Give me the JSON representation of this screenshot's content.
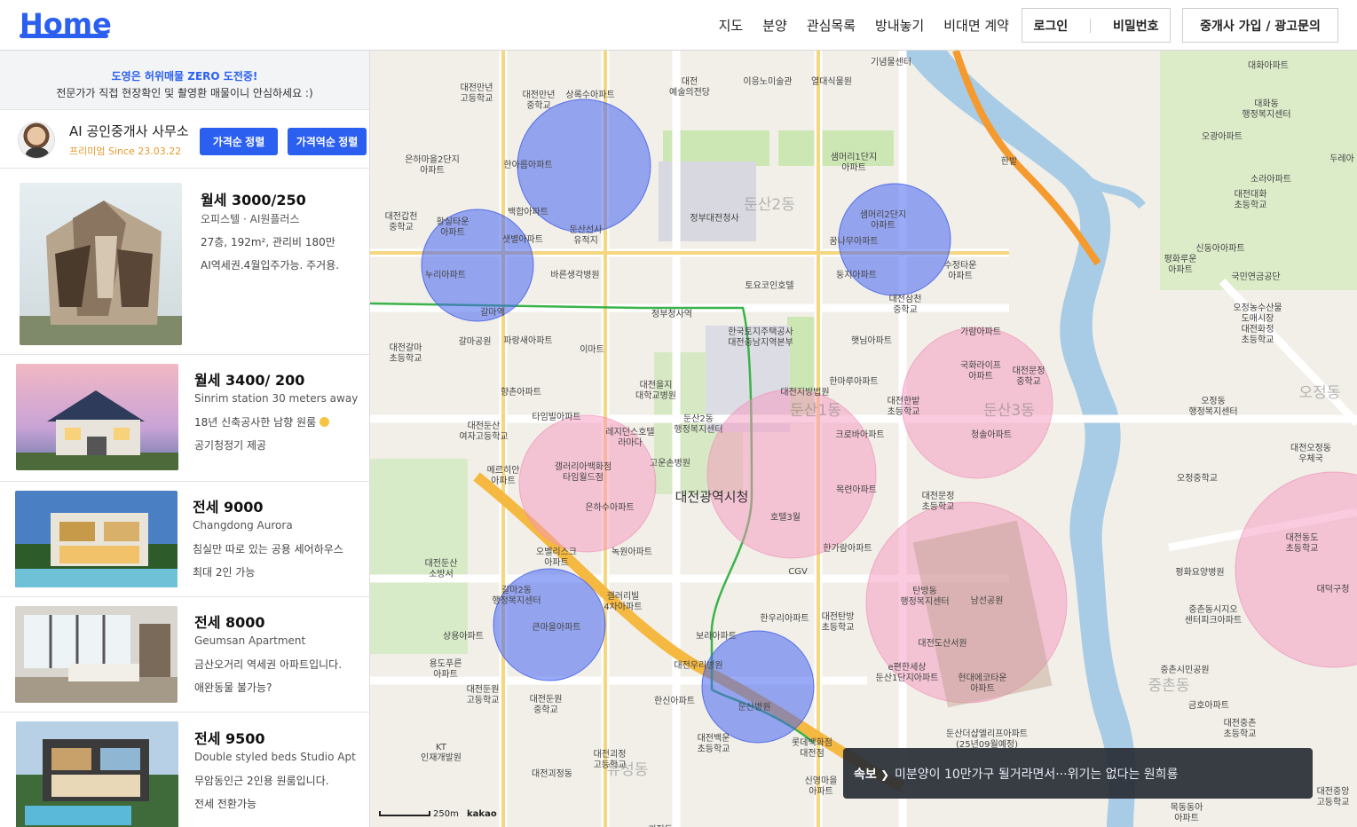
{
  "header": {
    "logo": "Home",
    "nav": [
      "지도",
      "분양",
      "관심목록",
      "방내놓기",
      "비대면 계약"
    ],
    "login": "로그인",
    "password": "비밀번호",
    "agent_signup": "중개사 가입 / 광고문의"
  },
  "notice": {
    "line1": "도영은 허위매물 ZERO 도전중!",
    "line2": "전문가가 직접 현장확인 및 촬영환 매물이니 안심하세요 :)"
  },
  "agent": {
    "name": "AI 공인중개사 사무소",
    "since": "프리미엄 Since 23.03.22",
    "sort_price": "가격순 정렬",
    "sort_price_desc": "가격역순 정렬"
  },
  "listings": [
    {
      "price": "월세 3000/250",
      "sub": "오피스텔 · AI원플러스",
      "line1": "27층, 192m², 관리비 180만",
      "line2": "AI역세권.4월입주가능. 주거용."
    },
    {
      "price": "월세 3400/ 200",
      "sub": "Sinrim station 30 meters away",
      "line1": "18년 신축공사한 남향 원룸",
      "line2": "공기청정기 제공"
    },
    {
      "price": "전세 9000",
      "sub": "Changdong Aurora",
      "line1": "침실만 따로 있는 공용 세어하우스",
      "line2": "최대 2인 가능"
    },
    {
      "price": "전세 8000",
      "sub": "Geumsan Apartment",
      "line1": "금산오거리 역세권 아파트입니다.",
      "line2": "애완동물 불가능?"
    },
    {
      "price": "전세 9500",
      "sub": "Double styled beds Studio Apt",
      "line1": "무암동인근 2인용 원룸입니다.",
      "line2": "전세 전환가능"
    }
  ],
  "map": {
    "labels": [
      {
        "t": "대전만년\n고등학교"
      },
      {
        "t": "대전만년\n중학교"
      },
      {
        "t": "상록수아파트"
      },
      {
        "t": "대전\n예술의전당"
      },
      {
        "t": "이응노미술관"
      },
      {
        "t": "열대식물원"
      },
      {
        "t": "기념물센터"
      },
      {
        "t": "은하마을2단지\n아파트"
      },
      {
        "t": "한아름아파트"
      },
      {
        "t": "정부대전청사"
      },
      {
        "t": "샘머리1단지\n아파트"
      },
      {
        "t": "샘머리2단지\n아파트"
      },
      {
        "t": "대전갑천\n중학교"
      },
      {
        "t": "황실타운\n아파트"
      },
      {
        "t": "백합아파트"
      },
      {
        "t": "둔산선사\n유적지"
      },
      {
        "t": "꿈나무아파트"
      },
      {
        "t": "수정타운\n아파트"
      },
      {
        "t": "샛별아파트"
      },
      {
        "t": "누리아파트"
      },
      {
        "t": "바른생각병원"
      },
      {
        "t": "토요코인호텔"
      },
      {
        "t": "둥지아파트"
      },
      {
        "t": "대전삼천\n중학교"
      },
      {
        "t": "갈마역"
      },
      {
        "t": "정부청사역"
      },
      {
        "t": "한국토지주택공사\n대전충남지역본부"
      },
      {
        "t": "햇님아파트"
      },
      {
        "t": "가람아파트"
      },
      {
        "t": "대전갈마\n초등학교"
      },
      {
        "t": "갈마공원"
      },
      {
        "t": "파랑새아파트"
      },
      {
        "t": "이마트"
      },
      {
        "t": "한마루아파트"
      },
      {
        "t": "국화라이프\n아파트"
      },
      {
        "t": "대전문정\n중학교"
      },
      {
        "t": "향촌아파트"
      },
      {
        "t": "대전을지\n대학교병원"
      },
      {
        "t": "대전지방법원"
      },
      {
        "t": "대전한밭\n초등학교"
      },
      {
        "t": "대전둔산\n여자고등학교"
      },
      {
        "t": "타임빌아파트"
      },
      {
        "t": "레지던스호텔\n라마다"
      },
      {
        "t": "둔산2동\n행정복지센터"
      },
      {
        "t": "크로바아파트"
      },
      {
        "t": "청솔아파트"
      },
      {
        "t": "메르히안\n아파트"
      },
      {
        "t": "갤러리아백화점\n타임월드점"
      },
      {
        "t": "고운손병원"
      },
      {
        "t": "목련아파트"
      },
      {
        "t": "대전문정\n초등학교"
      },
      {
        "t": "은하수아파트"
      },
      {
        "t": "대전광역시청"
      },
      {
        "t": "호텔3월"
      },
      {
        "t": "오벨리스크\n아파트"
      },
      {
        "t": "녹원아파트"
      },
      {
        "t": "한가람아파트"
      },
      {
        "t": "대전둔산\n소방서"
      },
      {
        "t": "CGV"
      },
      {
        "t": "갈마2동\n행정복지센터"
      },
      {
        "t": "갤러리빌\n4차아파트"
      },
      {
        "t": "탄방동\n행정복지센터"
      },
      {
        "t": "남선공원"
      },
      {
        "t": "큰마을아파트"
      },
      {
        "t": "한우리아파트"
      },
      {
        "t": "대전탄방\n초등학교"
      },
      {
        "t": "상용아파트"
      },
      {
        "t": "보라아파트"
      },
      {
        "t": "대전도산서원"
      },
      {
        "t": "용도푸른\n아파트"
      },
      {
        "t": "대전우리병원"
      },
      {
        "t": "e편한세상\n둔산1단지아파트"
      },
      {
        "t": "현대에코타운\n아파트"
      },
      {
        "t": "대전둔원\n고등학교"
      },
      {
        "t": "대전둔원\n중학교"
      },
      {
        "t": "한신아파트"
      },
      {
        "t": "둔산병원"
      },
      {
        "t": "KT\n인재개발원"
      },
      {
        "t": "대전괴정\n고등학교"
      },
      {
        "t": "대전백운\n초등학교"
      },
      {
        "t": "롯데백화점\n대전점"
      },
      {
        "t": "둔산더샵엘리프아파트\n(25년09월예정)"
      },
      {
        "t": "신영마을\n아파트"
      },
      {
        "t": "대전괴정동"
      },
      {
        "t": "괴정동"
      },
      {
        "t": "대화아파트"
      },
      {
        "t": "대화동\n행정복지센터"
      },
      {
        "t": "오광아파트"
      },
      {
        "t": "소라아파트"
      },
      {
        "t": "대전대화\n초등학교"
      },
      {
        "t": "두레아"
      },
      {
        "t": "평화루운\n아파트"
      },
      {
        "t": "신동아아파트"
      },
      {
        "t": "국민연금공단"
      },
      {
        "t": "오정농수산물\n도매시장"
      },
      {
        "t": "대전화정\n초등학교"
      },
      {
        "t": "오정동\n행정복지센터"
      },
      {
        "t": "대전오정동\n우체국"
      },
      {
        "t": "오정중학교"
      },
      {
        "t": "대전동도\n초등학교"
      },
      {
        "t": "평화요양병원"
      },
      {
        "t": "중촌동시지오\n센터피크아파트"
      },
      {
        "t": "대덕구청"
      },
      {
        "t": "중촌시민공원"
      },
      {
        "t": "금호아파트"
      },
      {
        "t": "대전중촌\n초등학교"
      },
      {
        "t": "대전중앙\n고등학교"
      },
      {
        "t": "목동동아\n아파트"
      },
      {
        "t": "한밭"
      },
      {
        "t": "둔산2동"
      },
      {
        "t": "둔산1동"
      },
      {
        "t": "둔산3동"
      },
      {
        "t": "오정동"
      },
      {
        "t": "중촌동"
      },
      {
        "t": "유성동"
      }
    ],
    "news_tag": "속보",
    "news_text": "미분양이 10만가구 될거라면서···위기는 없다는 원희룡",
    "scale": "250m",
    "attribution": "kakao"
  }
}
